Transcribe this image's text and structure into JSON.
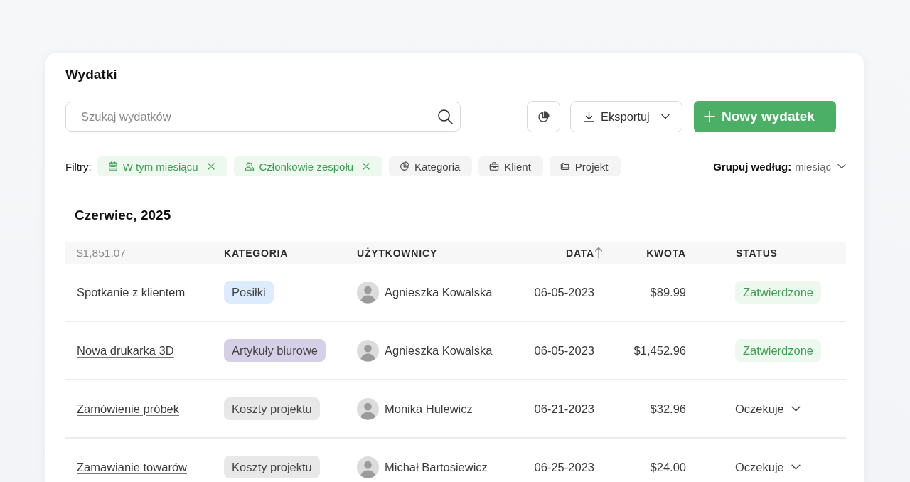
{
  "title": "Wydatki",
  "search": {
    "placeholder": "Szukaj wydatków"
  },
  "actions": {
    "export": "Eksportuj",
    "new": "Nowy wydatek"
  },
  "filters": {
    "label": "Filtry:",
    "items": [
      {
        "label": "W tym miesiącu",
        "active": true
      },
      {
        "label": "Członkowie zespołu",
        "active": true
      },
      {
        "label": "Kategoria",
        "active": false
      },
      {
        "label": "Klient",
        "active": false
      },
      {
        "label": "Projekt",
        "active": false
      }
    ]
  },
  "group_by": {
    "label": "Grupuj według:",
    "value": "miesiąc"
  },
  "group": {
    "heading": "Czerwiec, 2025"
  },
  "table": {
    "total": "$1,851.07",
    "columns": [
      {
        "label": "KATEGORIA",
        "sorted": false
      },
      {
        "label": "UŻYTKOWNICY",
        "sorted": false
      },
      {
        "label": "DATA",
        "sorted": true
      },
      {
        "label": "KWOTA",
        "sorted": false
      },
      {
        "label": "STATUS",
        "sorted": false
      }
    ],
    "rows": [
      {
        "title": "Spotkanie z klientem",
        "category": {
          "label": "Posiłki",
          "color": "#dcebfd"
        },
        "user": "Agnieszka Kowalska",
        "date": "06-05-2023",
        "amount": "$89.99",
        "status": {
          "kind": "badge",
          "label": "Zatwierdzone"
        }
      },
      {
        "title": "Nowa drukarka 3D",
        "category": {
          "label": "Artykuły biurowe",
          "color": "#d5d0e8"
        },
        "user": "Agnieszka Kowalska",
        "date": "06-05-2023",
        "amount": "$1,452.96",
        "status": {
          "kind": "badge",
          "label": "Zatwierdzone"
        }
      },
      {
        "title": "Zamówienie próbek",
        "category": {
          "label": "Koszty projektu",
          "color": "#e8e8e8"
        },
        "user": "Monika Hulewicz",
        "date": "06-21-2023",
        "amount": "$32.96",
        "status": {
          "kind": "dropdown",
          "label": "Oczekuje"
        }
      },
      {
        "title": "Zamawianie towarów",
        "category": {
          "label": "Koszty projektu",
          "color": "#e8e8e8"
        },
        "user": "Michał Bartosiewicz",
        "date": "06-25-2023",
        "amount": "$24.00",
        "status": {
          "kind": "dropdown",
          "label": "Oczekuje"
        }
      }
    ]
  }
}
